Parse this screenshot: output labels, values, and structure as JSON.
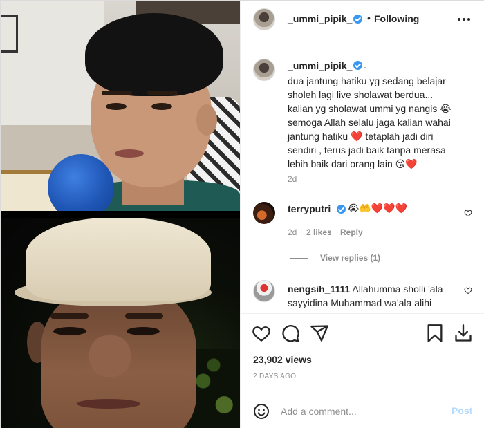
{
  "post": {
    "username": "_ummi_pipik_",
    "follow_status": "Following",
    "separator": "•",
    "more_icon": "more-horizontal-icon"
  },
  "caption": {
    "username": "_ummi_pipik_",
    "suffix": ".",
    "text": "dua jantung hatiku yg sedang belajar\nsholeh lagi live sholawat berdua...\nkalian yg sholawat ummi yg nangis 😭\nsemoga Allah selalu jaga kalian wahai\njantung hatiku ❤️ tetaplah jadi diri\nsendiri , terus jadi baik tanpa merasa\nlebih baik dari orang lain 😘❤️",
    "time": "2d"
  },
  "comments": [
    {
      "username": "terryputri",
      "text": "😭🤲❤️❤️❤️",
      "time": "2d",
      "likes": "2 likes",
      "reply_label": "Reply",
      "view_replies": "View replies (1)"
    },
    {
      "username": "nengsih_1111",
      "text": "Allahumma sholli 'ala sayyidina Muhammad wa'ala alihi"
    }
  ],
  "actions": {
    "icons": [
      "heart-icon",
      "comment-icon",
      "share-icon",
      "save-icon",
      "download-icon"
    ],
    "views": "23,902 views",
    "posted_ago": "2 DAYS AGO"
  },
  "add_comment": {
    "placeholder": "Add a comment...",
    "post_label": "Post"
  },
  "colors": {
    "verified": "#3897f0",
    "post_disabled": "#b3dbff",
    "secondary_text": "#8e8e8e"
  }
}
